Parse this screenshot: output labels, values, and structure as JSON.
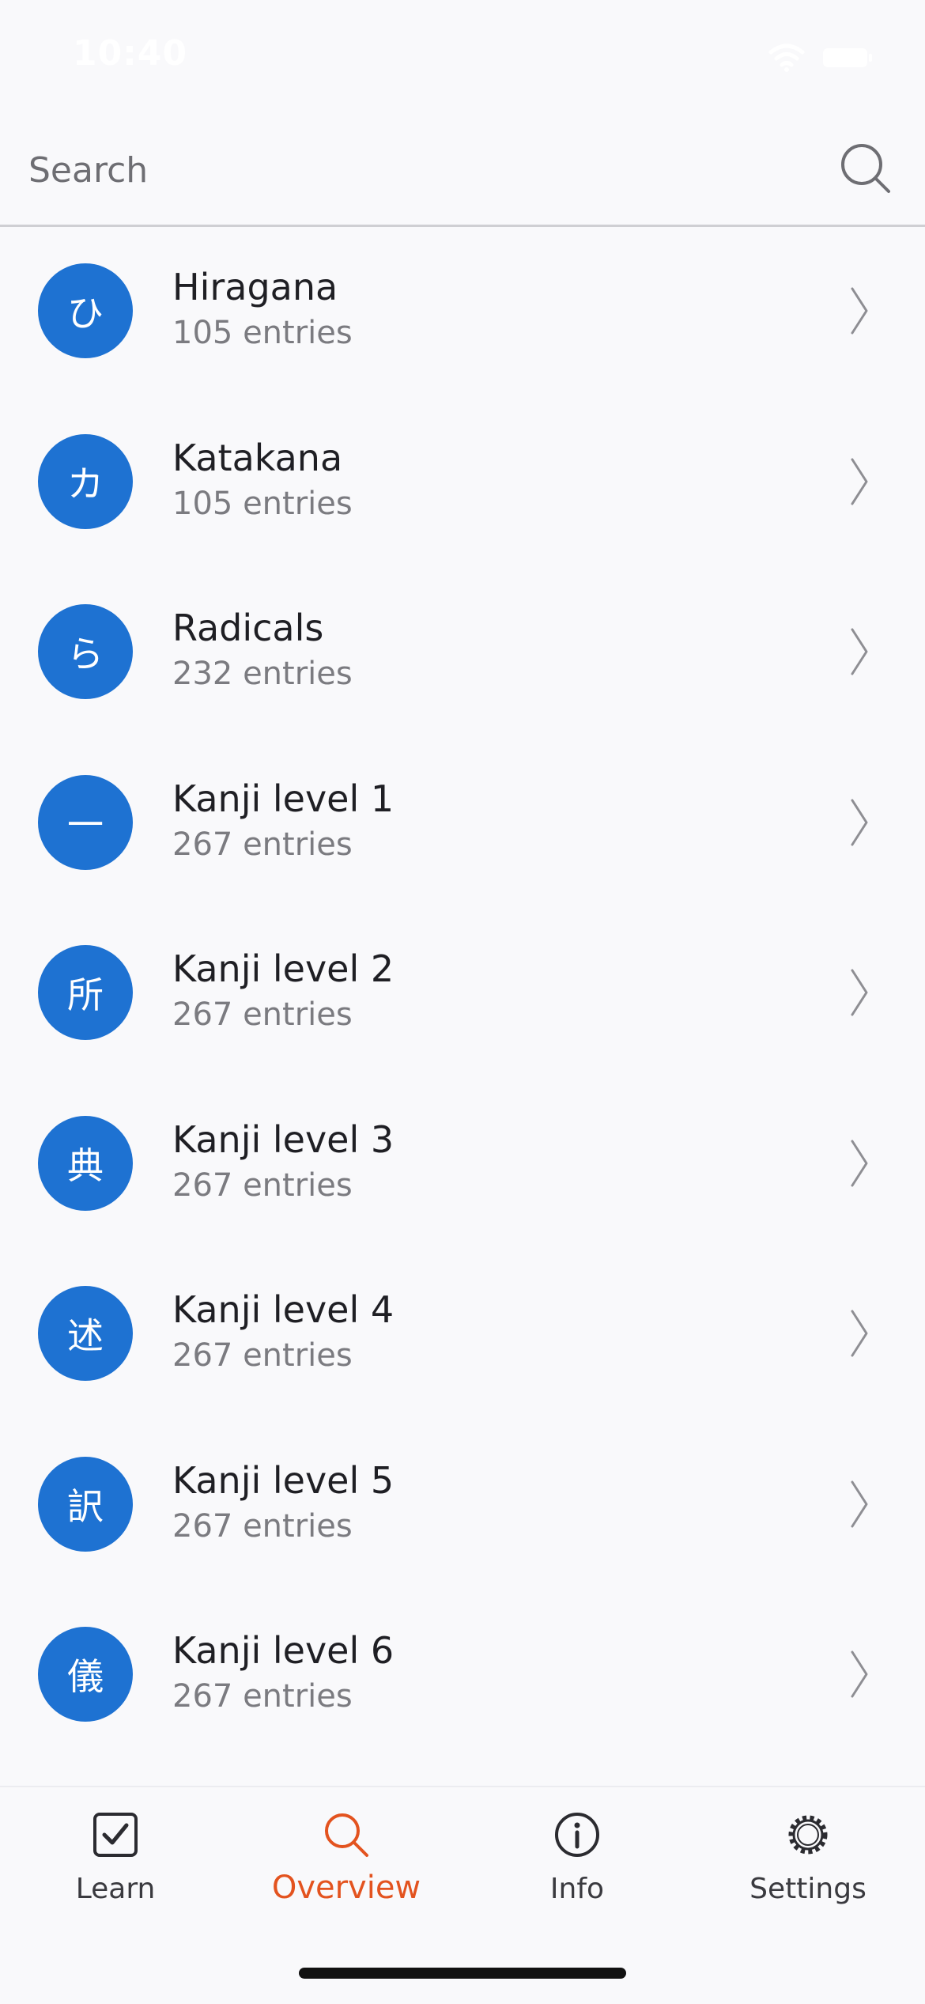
{
  "status_bar": {
    "time": "10:40"
  },
  "search": {
    "placeholder": "Search",
    "value": ""
  },
  "items": [
    {
      "glyph": "ひ",
      "title": "Hiragana",
      "subtitle": "105 entries"
    },
    {
      "glyph": "カ",
      "title": "Katakana",
      "subtitle": "105 entries"
    },
    {
      "glyph": "ら",
      "title": "Radicals",
      "subtitle": "232 entries"
    },
    {
      "glyph": "一",
      "title": "Kanji level 1",
      "subtitle": "267 entries"
    },
    {
      "glyph": "所",
      "title": "Kanji level 2",
      "subtitle": "267 entries"
    },
    {
      "glyph": "典",
      "title": "Kanji level 3",
      "subtitle": "267 entries"
    },
    {
      "glyph": "述",
      "title": "Kanji level 4",
      "subtitle": "267 entries"
    },
    {
      "glyph": "訳",
      "title": "Kanji level 5",
      "subtitle": "267 entries"
    },
    {
      "glyph": "儀",
      "title": "Kanji level 6",
      "subtitle": "267 entries"
    }
  ],
  "tabs": [
    {
      "label": "Learn",
      "icon": "checkbox-icon"
    },
    {
      "label": "Overview",
      "icon": "search-icon",
      "active": true
    },
    {
      "label": "Info",
      "icon": "info-icon"
    },
    {
      "label": "Settings",
      "icon": "gear-icon"
    }
  ],
  "colors": {
    "accent": "#1e72d2",
    "active_tab": "#e3531f",
    "background": "#f9f9fb"
  }
}
